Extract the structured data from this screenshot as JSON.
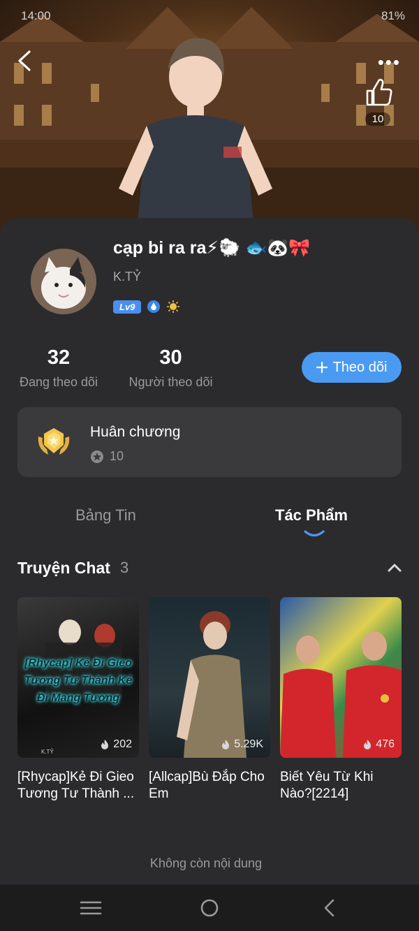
{
  "status_bar": {
    "time": "14:00",
    "battery": "81%"
  },
  "header": {
    "like_count": "10"
  },
  "profile": {
    "name": "cạp bi ra ra⚡🐑 🐟🐼🎀",
    "handle": "K.TỶ",
    "level": "Lv9"
  },
  "stats": {
    "following": {
      "value": "32",
      "label": "Đang theo dõi"
    },
    "followers": {
      "value": "30",
      "label": "Người theo dõi"
    }
  },
  "follow_button": {
    "label": "Theo dõi"
  },
  "medal": {
    "title": "Huân chương",
    "count": "10"
  },
  "tabs": [
    {
      "label": "Bảng Tin"
    },
    {
      "label": "Tác Phẩm"
    }
  ],
  "section": {
    "title": "Truyện Chat",
    "count": "3"
  },
  "stories": [
    {
      "title": "[Rhycap]Kẻ Đi Gieo Tương Tư Thành ...",
      "views": "202",
      "cover_text": "[Rhycap] Kẻ Đi Gieo Tương Tư Thành Kẻ Đi Mang Tương",
      "cover_author": "K.TỶ"
    },
    {
      "title": "[Allcap]Bù Đắp Cho Em",
      "views": "5.29K"
    },
    {
      "title": "Biết Yêu Từ Khi Nào?[2214]",
      "views": "476"
    }
  ],
  "footer": {
    "text": "Không còn nội dung"
  },
  "colors": {
    "accent": "#4a9af2",
    "background": "#2b2b2d",
    "card": "#3a3a3c"
  }
}
